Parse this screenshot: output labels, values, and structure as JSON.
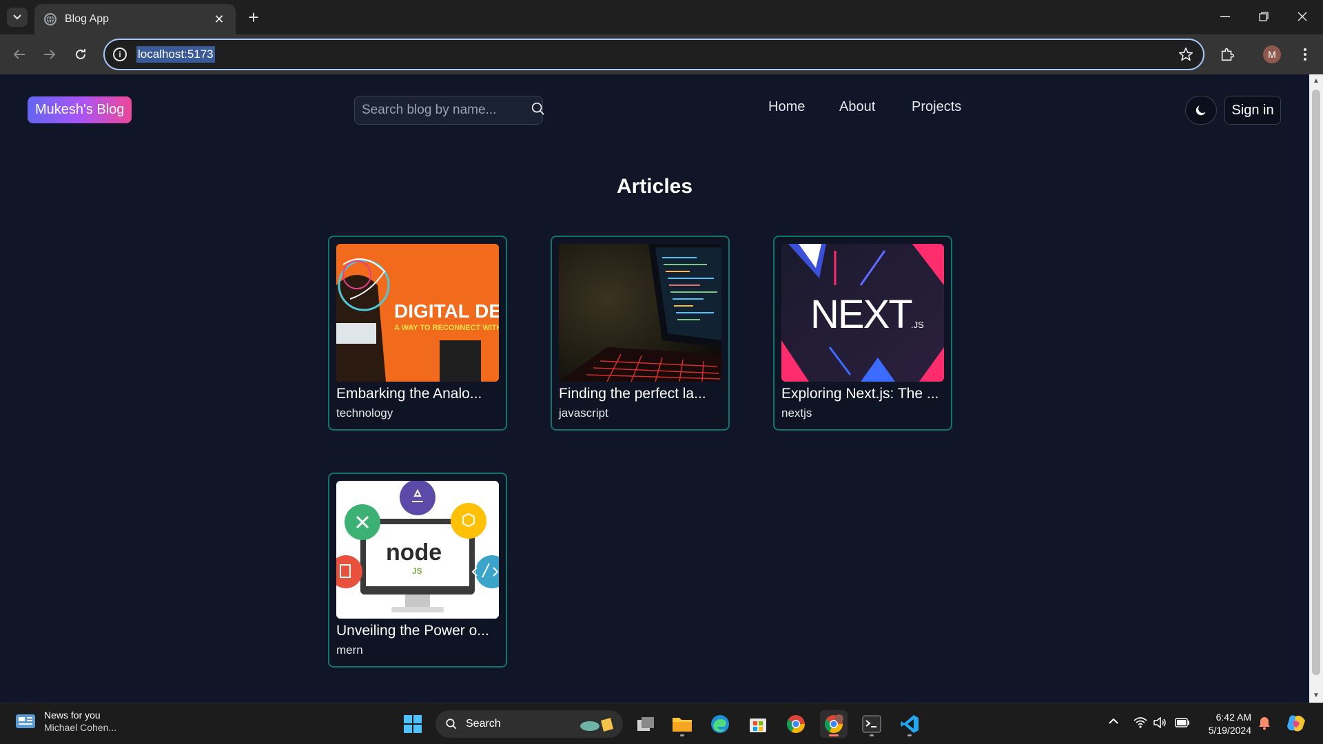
{
  "browser": {
    "tab_title": "Blog App",
    "url": "localhost:5173"
  },
  "header": {
    "logo": "Mukesh's Blog",
    "search_placeholder": "Search blog by name...",
    "nav": [
      "Home",
      "About",
      "Projects"
    ],
    "signin": "Sign in"
  },
  "main": {
    "heading": "Articles",
    "articles": [
      {
        "title": "Embarking the Analo...",
        "category": "technology",
        "image_text": "DIGITAL DET",
        "image_subtext": "A WAY TO RECONNECT WITH"
      },
      {
        "title": "Finding the perfect la...",
        "category": "javascript"
      },
      {
        "title": "Exploring Next.js: The ...",
        "category": "nextjs",
        "image_text": "NEXT",
        "image_subtext": ".JS"
      },
      {
        "title": "Unveiling the Power o...",
        "category": "mern",
        "image_text": "node",
        "image_subtext": "JS"
      }
    ]
  },
  "taskbar": {
    "news_title": "News for you",
    "news_sub": "Michael Cohen...",
    "search_label": "Search",
    "time": "6:42 AM",
    "date": "5/19/2024"
  },
  "colors": {
    "page_bg": "#101527",
    "card_border": "#0f766e",
    "logo_gradient": [
      "#6366f1",
      "#a855f7",
      "#ec4899"
    ]
  }
}
